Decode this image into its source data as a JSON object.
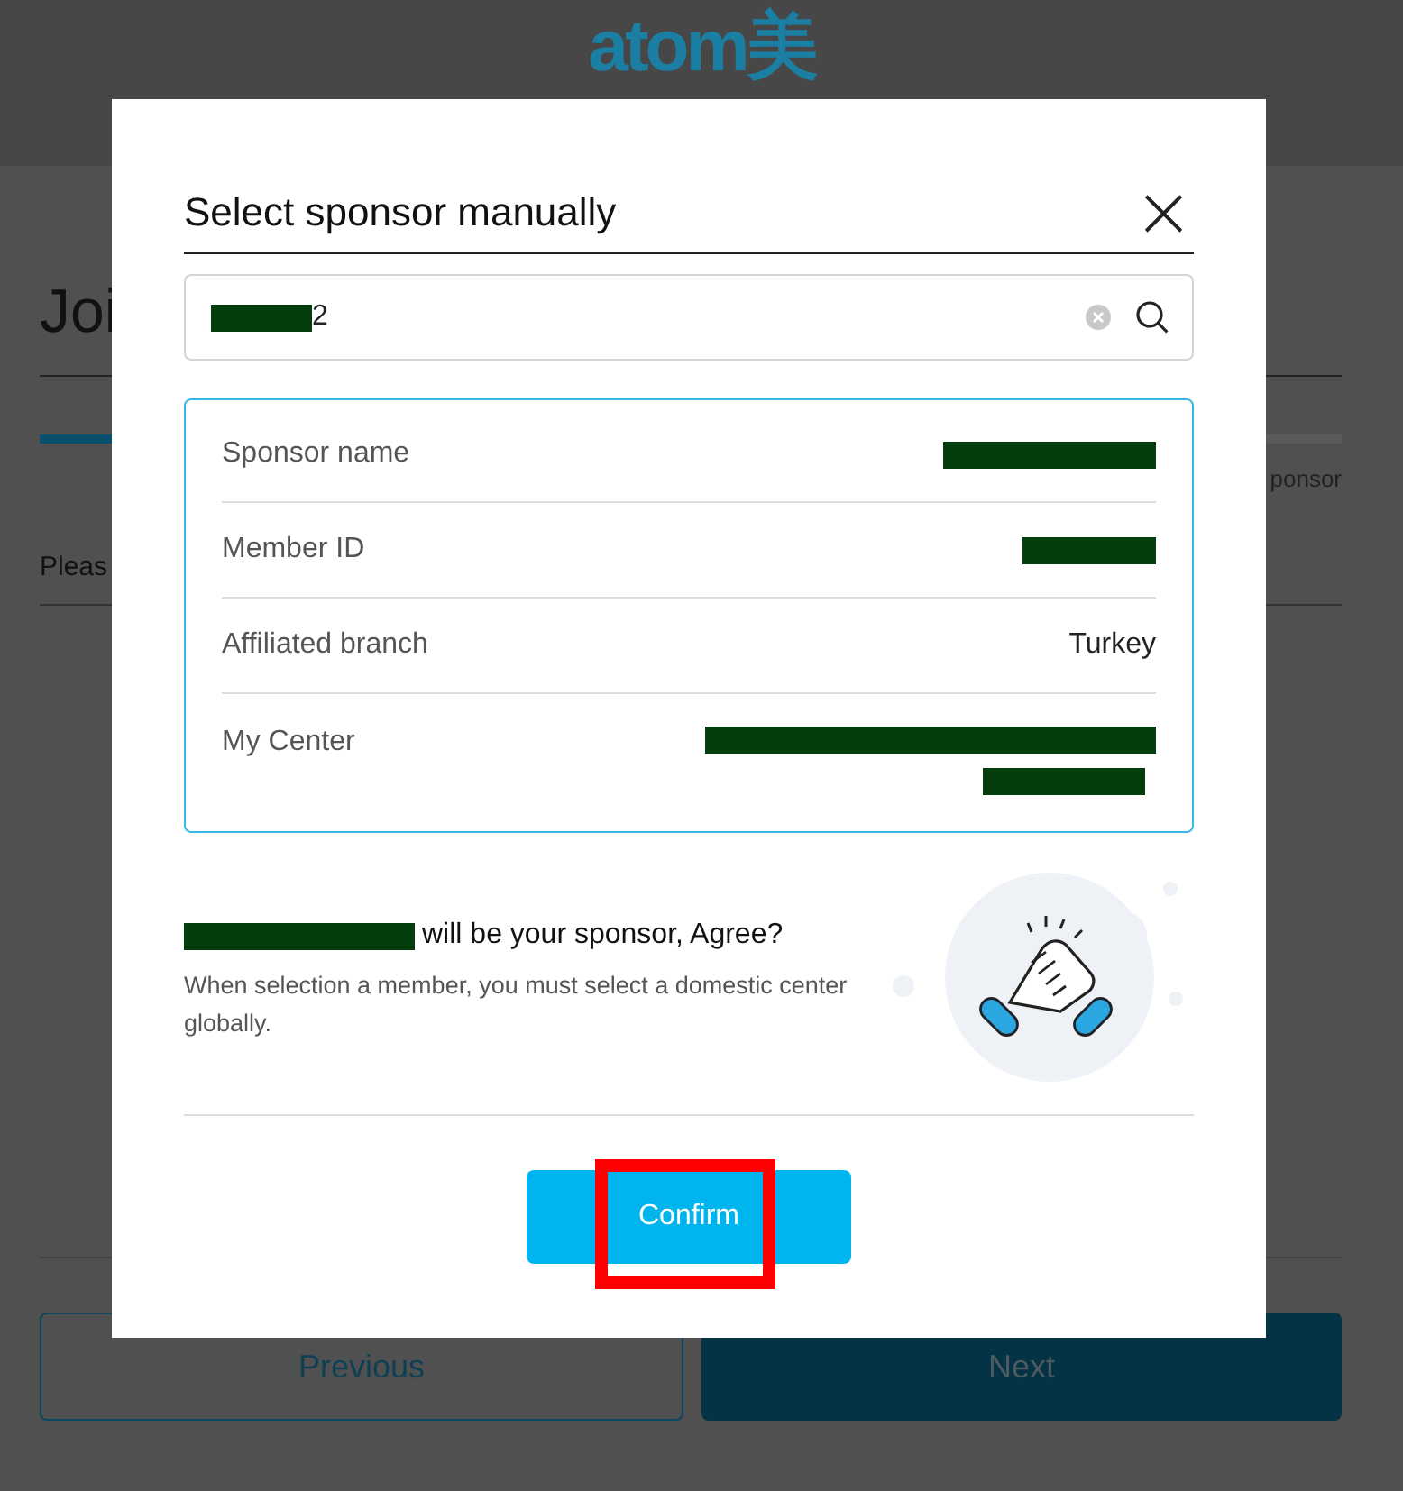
{
  "page": {
    "logo": "atom美",
    "heading": "Joi",
    "step_label": "ponsor",
    "progress": {
      "level": 0.06
    },
    "prompt": "Pleas",
    "buttons": [
      {
        "label": "Previous",
        "kind": "outline"
      },
      {
        "label": "Next",
        "kind": "filled"
      }
    ]
  },
  "dialog": {
    "title": "Select sponsor manually",
    "close": "×",
    "search": {
      "value": "2"
    },
    "details": [
      {
        "label": "Sponsor name"
      },
      {
        "label": "Member ID"
      },
      {
        "label": "Affiliated branch",
        "value": "Turkey"
      },
      {
        "label": "My Center"
      }
    ],
    "agree": "will be your sponsor, Agree?",
    "note": "When selection a member, you must select a domestic center globally.",
    "confirm": "Confirm",
    "highlighted": true
  }
}
